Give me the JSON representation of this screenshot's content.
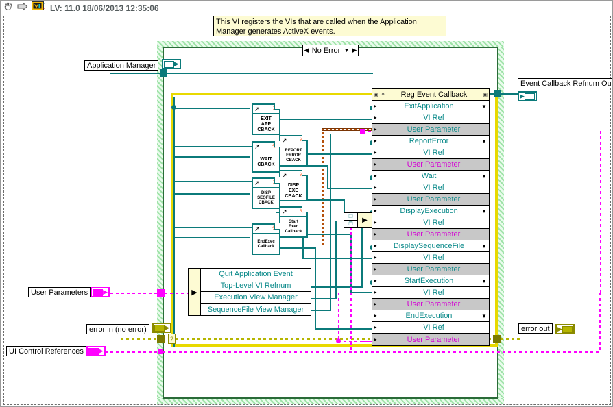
{
  "titlebar": {
    "hand_icon": "hand-cursor-icon",
    "arrow_icon": "run-arrow-icon",
    "vi_icon": "labview-vi-icon",
    "text": "LV: 11.0 18/06/2013 12:35:06"
  },
  "comment": {
    "text": "This VI registers the VIs that are called when the Application Manager generates ActiveX events."
  },
  "case_structure": {
    "selector_label": "No Error",
    "left_arrow": "◀",
    "right_arrow": "▶",
    "down_arrow": "▼"
  },
  "controls": [
    {
      "name": "application-manager",
      "label": "Application Manager",
      "type": "refnum",
      "color": "#0b7a7a"
    },
    {
      "name": "user-parameters",
      "label": "User Parameters",
      "type": "cluster",
      "color": "#ff00ff"
    },
    {
      "name": "error-in",
      "label": "error in (no error)",
      "type": "error",
      "color": "#8a8a00"
    },
    {
      "name": "ui-control-references",
      "label": "UI Control References",
      "type": "cluster",
      "color": "#ff00ff"
    }
  ],
  "indicators": [
    {
      "name": "event-callback-refnum-out",
      "label": "Event Callback Refnum Out",
      "type": "refnum",
      "color": "#0b7a7a"
    },
    {
      "name": "error-out",
      "label": "error out",
      "type": "error",
      "color": "#8a8a00"
    }
  ],
  "reg_event_callback": {
    "title": "Reg Event Callback",
    "vi_ref_label": "VI Ref",
    "user_parameter_label": "User Parameter",
    "dropdown_glyph": "▼",
    "input_glyph": "▸",
    "events": [
      {
        "name": "ExitApplication",
        "user_param_color": "teal"
      },
      {
        "name": "ReportError",
        "user_param_color": "magenta"
      },
      {
        "name": "Wait",
        "user_param_color": "teal"
      },
      {
        "name": "DisplayExecution",
        "user_param_color": "magenta"
      },
      {
        "name": "DisplaySequenceFile",
        "user_param_color": "teal"
      },
      {
        "name": "StartExecution",
        "user_param_color": "magenta"
      },
      {
        "name": "EndExecution",
        "user_param_color": "magenta"
      }
    ]
  },
  "unbundle": {
    "name": "unbundle-by-name",
    "input_glyph": "▶",
    "fields": [
      "Quit Application Event",
      "Top-Level VI Refnum",
      "Execution View Manager",
      "SequenceFile View Manager"
    ]
  },
  "callback_vis": [
    {
      "name": "exit-app-cback",
      "lines": [
        "EXIT",
        "APP",
        "CBACK"
      ],
      "small": false
    },
    {
      "name": "report-error-cback",
      "lines": [
        "REPORT",
        "ERROR",
        "CBACK"
      ],
      "small": false
    },
    {
      "name": "wait-cback",
      "lines": [
        "WAIT",
        "CBACK"
      ],
      "small": false
    },
    {
      "name": "disp-exe-cback",
      "lines": [
        "DISP",
        "EXE",
        "CBACK"
      ],
      "small": false
    },
    {
      "name": "disp-seqfile-cback",
      "lines": [
        "DISP",
        "SEQFILE",
        "CBACK"
      ],
      "small": false
    },
    {
      "name": "start-exec-callback",
      "lines": [
        "Start",
        "Exec",
        "Callback"
      ],
      "small": true
    },
    {
      "name": "endexec-callback",
      "lines": [
        "EndExec",
        "Callback"
      ],
      "small": true
    }
  ],
  "pair_node": {
    "name": "refnum-pair-node",
    "glyph_top": "❐",
    "glyph_bottom": "❐",
    "arrow": "▶"
  },
  "selector_terminal": {
    "label": "?"
  },
  "colors": {
    "refnum_teal": "#0b7a7a",
    "error_yellow": "#b5b500",
    "cluster_magenta": "#ff00ff",
    "sequence_green": "#9fe3a8",
    "comment_bg": "#fdfbd3",
    "node_bg": "#fdfbd3",
    "user_param_bg": "#c8c8c8",
    "vi_icon_star": "#ff5a1f"
  }
}
